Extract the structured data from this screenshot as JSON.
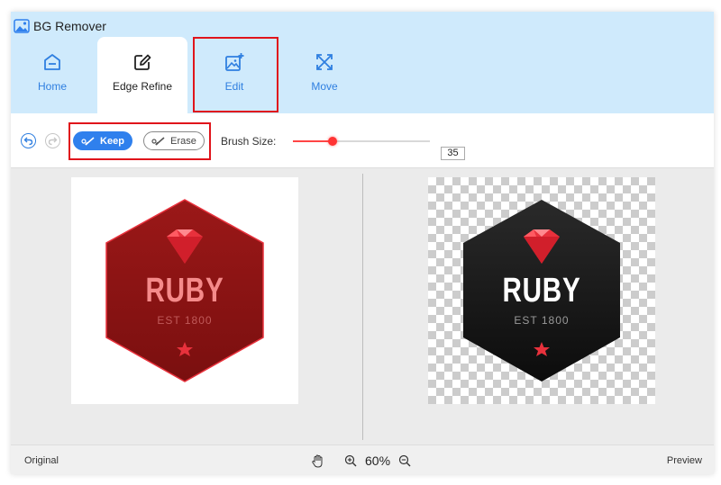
{
  "app": {
    "title": "BG Remover",
    "icon": "image-cloud-icon"
  },
  "tabs": [
    {
      "label": "Home",
      "icon": "home-icon",
      "active": false
    },
    {
      "label": "Edge Refine",
      "icon": "edit-pencil-icon",
      "active": true
    },
    {
      "label": "Edit",
      "icon": "image-edit-icon",
      "active": false,
      "highlighted": true
    },
    {
      "label": "Move",
      "icon": "move-arrows-icon",
      "active": false
    }
  ],
  "toolbar": {
    "undo_icon": "undo-icon",
    "redo_icon": "redo-icon",
    "keep_label": "Keep",
    "erase_label": "Erase",
    "brush_label": "Brush Size:",
    "brush_value": "35",
    "brush_fraction": 0.29
  },
  "badge": {
    "name": "RUBY",
    "established": "EST 1800"
  },
  "footer": {
    "original_label": "Original",
    "preview_label": "Preview",
    "zoom": "60%"
  },
  "colors": {
    "accent": "#2f80ed",
    "header_bg": "#cfeafc",
    "highlight": "#e0141b",
    "badge_original": "#8e1515",
    "badge_preview": "#1a1a1a",
    "badge_text_original": "#f58a8a",
    "gem_red": "#e8313c"
  }
}
